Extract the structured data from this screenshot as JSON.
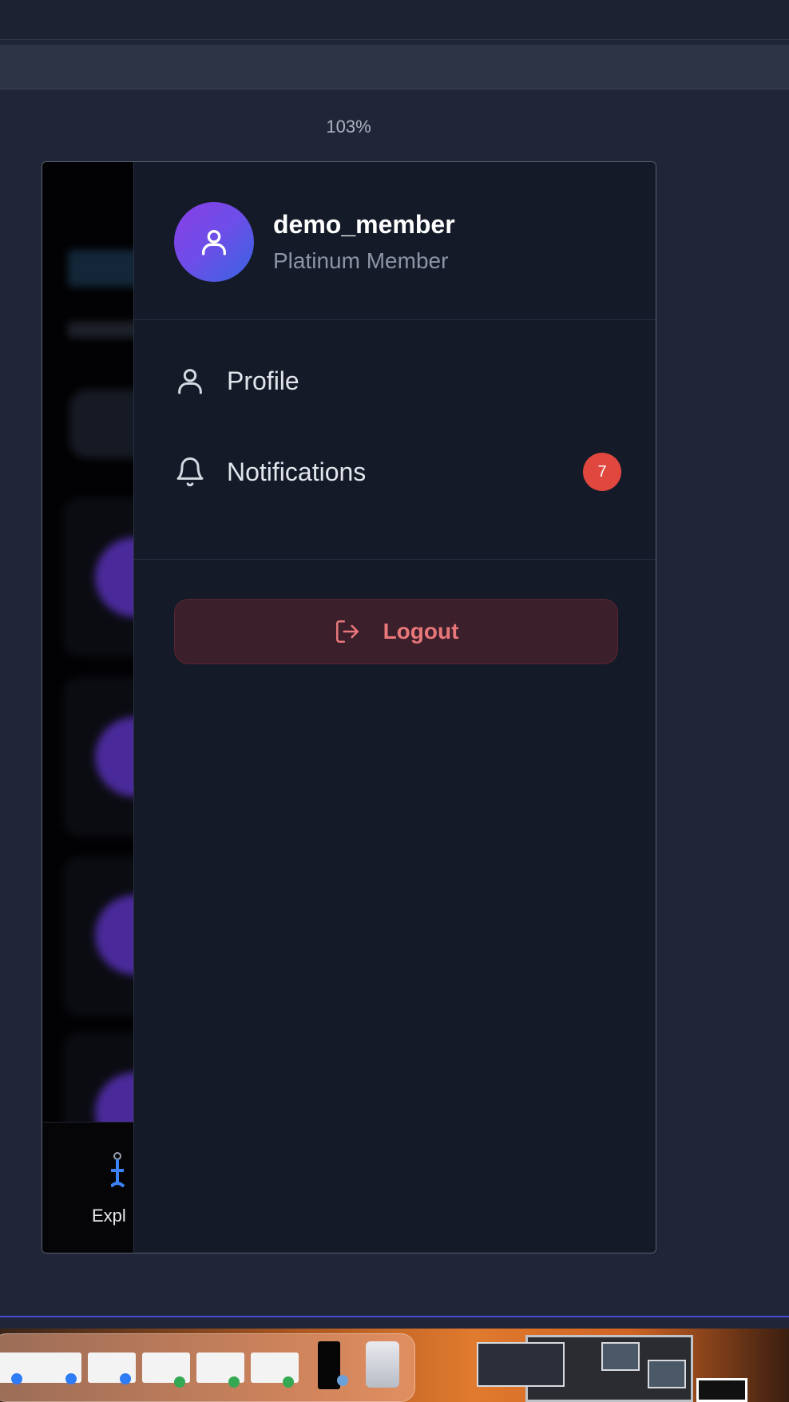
{
  "browser": {
    "zoom": "103%"
  },
  "background_app": {
    "nav_label": "Expl"
  },
  "drawer": {
    "user": {
      "name": "demo_member",
      "tier": "Platinum Member"
    },
    "menu": [
      {
        "label": "Profile",
        "icon": "user-icon"
      },
      {
        "label": "Notifications",
        "icon": "bell-icon",
        "badge": "7"
      }
    ],
    "logout_label": "Logout"
  },
  "colors": {
    "drawer_bg": "#141a27",
    "avatar_gradient_start": "#8a3ee6",
    "avatar_gradient_end": "#3766e2",
    "badge": "#e0483f",
    "logout_text": "#e8777a",
    "logout_bg": "#3b1f2a"
  }
}
